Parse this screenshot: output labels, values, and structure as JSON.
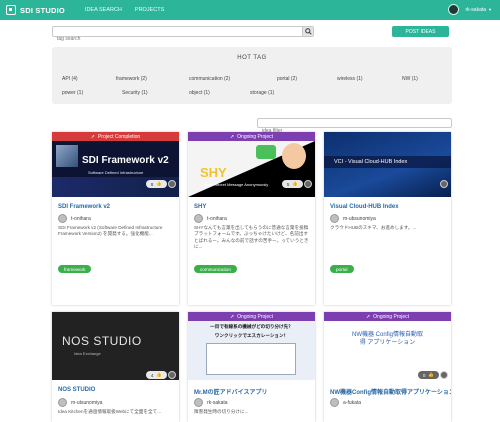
{
  "app": {
    "title": "SDI STUDIO",
    "user": "rk-sakata"
  },
  "nav": [
    "IDEA SEARCH",
    "PROJECTS"
  ],
  "search": {
    "placeholder": "tag search",
    "post_label": "POST IDEAS"
  },
  "hot_tag": {
    "title": "HOT TAG",
    "tags": [
      "API (4)",
      "framework (2)",
      "communication (2)",
      "portal (2)",
      "wireless (1)",
      "NW (1)",
      "power (1)",
      "Security (1)",
      "object (1)",
      "storage (1)"
    ]
  },
  "filter": {
    "placeholder": "idea filter"
  },
  "colors": {
    "accent": "#2db59a",
    "project_completion": "#d63a3a",
    "ongoing_project": "#7d3fb0",
    "tag_chip": "#3bb04a",
    "link": "#2a6aa4"
  },
  "cards": [
    {
      "status": "Project Completion",
      "image_title": "SDI Framework v2",
      "image_subtitle": "Software Defined Infrastructure",
      "likes": "8",
      "title": "SDI Framework v2",
      "author": "t-onihara",
      "description": "SDI Framework v2 (Software Defined Infrastructure Framework Version2) を開発する。強化機能...",
      "tag": "framework"
    },
    {
      "status": "Ongoing Project",
      "image_title": "SHY",
      "image_subtitle": "Send Secret Message Anonymously",
      "likes": "5",
      "title": "SHY",
      "author": "t-onihara",
      "description": "SHYなんても言葉を出してもらうのに普通な言葉を投稿プラットフォームです。ぶっちゃけたいけど、名前出すとばれるー。みんなの前で話すの苦手ー。っていうときに...",
      "tag": "communication"
    },
    {
      "status": "",
      "image_title": "VCI - Visual Cloud-HUB Index",
      "image_subtitle": "",
      "likes": "",
      "title": "Visual Cloud-HUB Index",
      "author": "m-ubsunomiya",
      "description": "クラウドHUBのスキマ、お進めします。...",
      "tag": "portal"
    },
    {
      "status": "",
      "image_title": "NOS STUDIO",
      "image_subtitle": "Idea Exchange",
      "likes": "4",
      "title": "NOS STUDIO",
      "author": "m-utsunomiya",
      "description": "Idea Kitchenを通過情報取扱Webにて全面を全て...",
      "tag": ""
    },
    {
      "status": "Ongoing Project",
      "image_title": "一目で有線系の機械がどの切り分け先？",
      "image_subtitle": "ワンクリックでエスカレーション！",
      "likes": "",
      "title": "Mr.Mの匠アドバイスアプリ",
      "author": "rk-sakata",
      "description": "障害発生時の切り分けに...",
      "tag": ""
    },
    {
      "status": "Ongoing Project",
      "image_title": "NW機器 Config情報自動取得 アプリケーション",
      "image_subtitle": "",
      "likes": "0",
      "title": "NW機器Config情報自動取得アプリケーション",
      "author": "a-fukata",
      "description": "",
      "tag": ""
    }
  ]
}
